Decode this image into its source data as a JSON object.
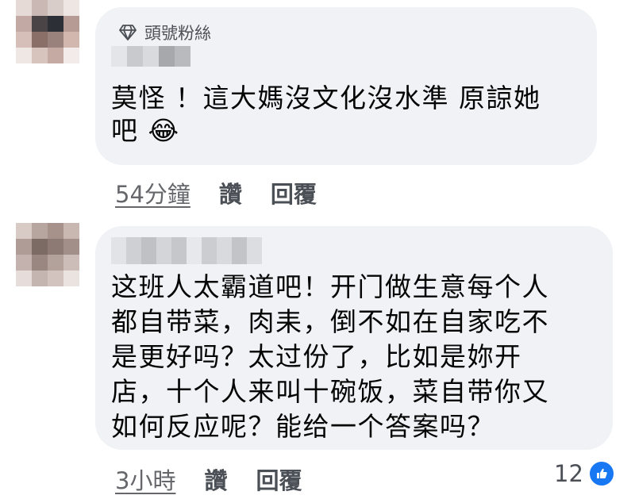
{
  "comments": [
    {
      "badge_icon": "diamond-icon",
      "badge_label": "頭號粉絲",
      "text_lines": [
        "莫怪 ！這大媽沒文化沒水準 原諒她",
        "吧"
      ],
      "emoji": "😂",
      "time": "54分鐘",
      "like_label": "讚",
      "reply_label": "回覆"
    },
    {
      "text_lines": [
        "这班人太霸道吧！开门做生意每个人",
        "都自带菜，肉耒，倒不如在自家吃不",
        "是更好吗？太过份了，比如是妳开",
        "店，十个人来叫十碗饭，菜自带你又",
        "如何反应呢？能给一个答案吗？"
      ],
      "time": "3小時",
      "like_label": "讚",
      "reply_label": "回覆",
      "reaction_count": "12",
      "reaction_icon": "thumbs-up-icon"
    }
  ],
  "colors": {
    "bubble_bg": "#f0f2f5",
    "like_blue": "#1877f2",
    "secondary_text": "#65676b"
  }
}
